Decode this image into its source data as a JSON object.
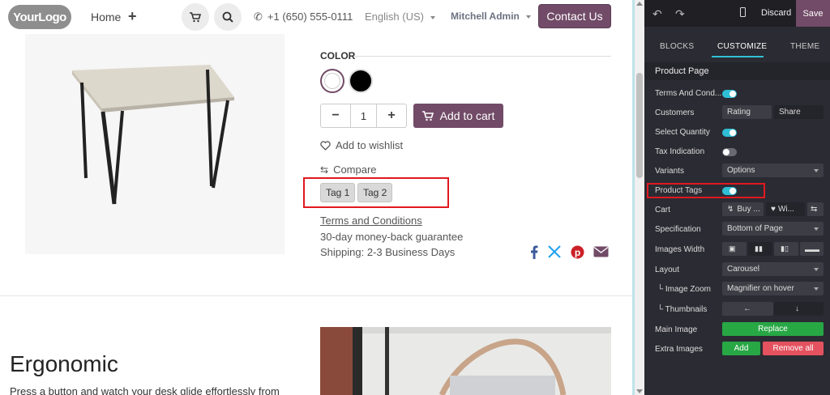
{
  "header": {
    "logo": "YourLogo",
    "home": "Home",
    "plus": "+",
    "phone": "+1 (650) 555-0111",
    "language": "English (US)",
    "user": "Mitchell Admin",
    "contact": "Contact Us"
  },
  "product": {
    "color_label": "COLOR",
    "quantity": "1",
    "qty_minus": "−",
    "qty_plus": "+",
    "add_to_cart": "Add to cart",
    "wishlist": "Add to wishlist",
    "compare": "Compare",
    "tags": [
      "Tag 1",
      "Tag 2"
    ],
    "terms": "Terms and Conditions",
    "guarantee": "30-day money-back guarantee",
    "shipping": "Shipping: 2-3 Business Days",
    "share_icons": [
      "facebook-icon",
      "x-icon",
      "pinterest-icon",
      "email-icon"
    ],
    "share_colors": [
      "#3b5998",
      "#1da1f2",
      "#cb2027",
      "#714b67"
    ]
  },
  "section": {
    "title": "Ergonomic",
    "text": "Press a button and watch your desk glide effortlessly from"
  },
  "editor": {
    "discard": "Discard",
    "save": "Save",
    "tabs": [
      "BLOCKS",
      "CUSTOMIZE",
      "THEME"
    ],
    "active_tab": "CUSTOMIZE",
    "section_title": "Product Page",
    "rows": {
      "terms": "Terms And Cond...",
      "customers": "Customers",
      "customers_opt1": "Rating",
      "customers_opt2": "Share",
      "select_qty": "Select Quantity",
      "tax": "Tax Indication",
      "variants": "Variants",
      "variants_value": "Options",
      "product_tags": "Product Tags",
      "cart": "Cart",
      "cart_opt1": "Buy ...",
      "cart_opt2": "Wi...",
      "specification": "Specification",
      "specification_value": "Bottom of Page",
      "images_width": "Images Width",
      "layout": "Layout",
      "layout_value": "Carousel",
      "image_zoom": "└ Image Zoom",
      "image_zoom_value": "Magnifier on hover",
      "thumbnails": "└ Thumbnails",
      "thumb_left": "←",
      "thumb_down": "↓",
      "main_image": "Main Image",
      "replace": "Replace",
      "extra_images": "Extra Images",
      "add": "Add",
      "remove_all": "Remove all"
    },
    "toggles": {
      "terms": true,
      "select_qty": true,
      "tax": false,
      "product_tags": true
    },
    "accent": "#2fbfd5",
    "brand": "#714b67"
  }
}
